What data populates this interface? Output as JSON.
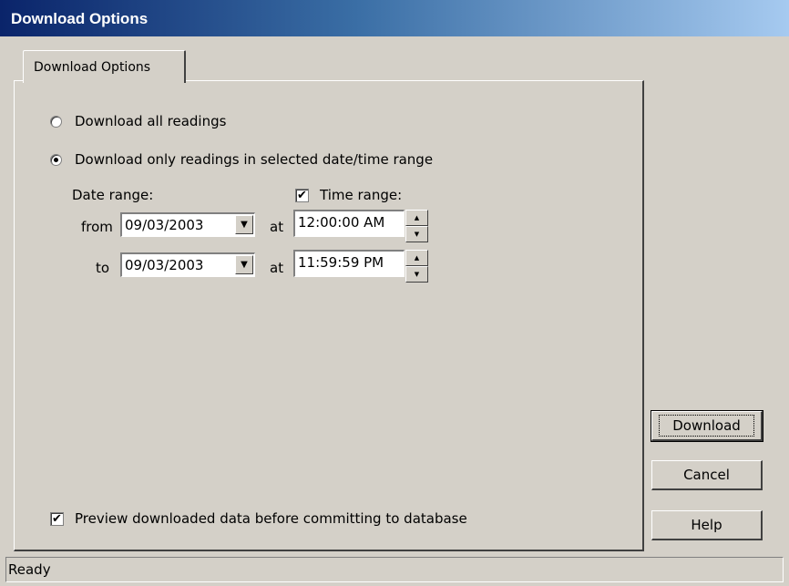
{
  "window": {
    "title": "Download Options"
  },
  "tabs": [
    {
      "label": "Download Options"
    }
  ],
  "options": {
    "all_label": "Download all readings",
    "range_label": "Download only readings in selected date/time range",
    "selected": "range"
  },
  "date_range": {
    "label": "Date range:",
    "from_label": "from",
    "to_label": "to",
    "from_date": "09/03/2003",
    "to_date": "09/03/2003"
  },
  "time_range": {
    "label": "Time range:",
    "checked": true,
    "at_label": "at",
    "from_time": "12:00:00 AM",
    "to_time": "11:59:59 PM"
  },
  "preview": {
    "label": "Preview downloaded data before committing to database",
    "checked": true
  },
  "buttons": {
    "download": "Download",
    "cancel": "Cancel",
    "help": "Help"
  },
  "status": {
    "text": "Ready"
  },
  "icons": {
    "check": "✔",
    "dropdown": "▼",
    "spin_up": "▲",
    "spin_down": "▼"
  }
}
